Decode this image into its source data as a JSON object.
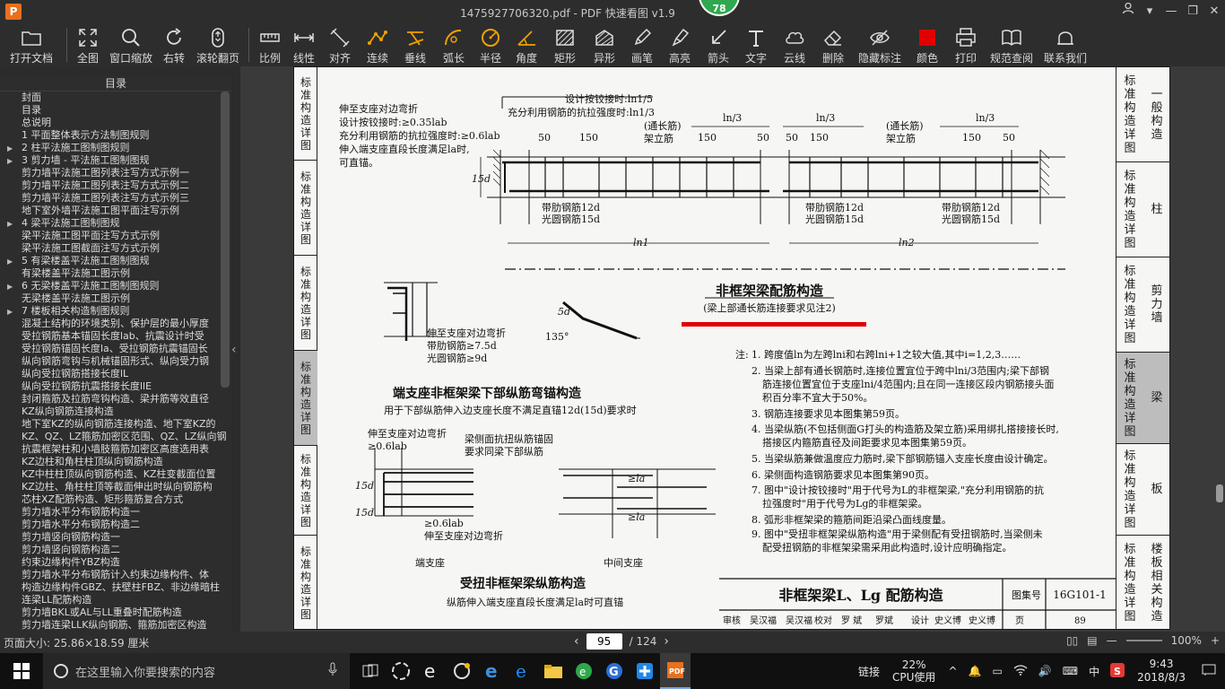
{
  "window": {
    "title": "1475927706320.pdf - PDF 快速看图 v1.9",
    "logo": "P",
    "badge": "78"
  },
  "toolbar": [
    {
      "id": "open",
      "label": "打开文档",
      "icon": "folder-icon"
    },
    {
      "id": "fit",
      "label": "全图",
      "icon": "fullscreen-icon"
    },
    {
      "id": "zoomwin",
      "label": "窗口缩放",
      "icon": "magnifier-icon"
    },
    {
      "id": "rotate",
      "label": "右转",
      "icon": "rotate-icon"
    },
    {
      "id": "scroll",
      "label": "滚轮翻页",
      "icon": "mouse-icon"
    },
    {
      "id": "scale",
      "label": "比例",
      "icon": "ruler-icon"
    },
    {
      "id": "linear",
      "label": "线性",
      "icon": "linear-dim-icon"
    },
    {
      "id": "align",
      "label": "对齐",
      "icon": "aligned-dim-icon"
    },
    {
      "id": "chain",
      "label": "连续",
      "icon": "chain-dim-icon"
    },
    {
      "id": "perp",
      "label": "垂线",
      "icon": "perpendicular-icon"
    },
    {
      "id": "arclen",
      "label": "弧长",
      "icon": "arc-length-icon"
    },
    {
      "id": "radius",
      "label": "半径",
      "icon": "radius-icon"
    },
    {
      "id": "angle",
      "label": "角度",
      "icon": "angle-icon"
    },
    {
      "id": "rect",
      "label": "矩形",
      "icon": "rectangle-area-icon"
    },
    {
      "id": "poly",
      "label": "异形",
      "icon": "polygon-area-icon"
    },
    {
      "id": "pen",
      "label": "画笔",
      "icon": "pen-icon"
    },
    {
      "id": "highlight",
      "label": "高亮",
      "icon": "highlighter-icon"
    },
    {
      "id": "arrow",
      "label": "箭头",
      "icon": "arrow-icon"
    },
    {
      "id": "text",
      "label": "文字",
      "icon": "text-icon"
    },
    {
      "id": "cloud",
      "label": "云线",
      "icon": "cloud-line-icon"
    },
    {
      "id": "erase",
      "label": "删除",
      "icon": "eraser-icon"
    },
    {
      "id": "hide",
      "label": "隐藏标注",
      "icon": "eye-hide-icon"
    },
    {
      "id": "color",
      "label": "颜色",
      "icon": "color-swatch-icon"
    },
    {
      "id": "print",
      "label": "打印",
      "icon": "printer-icon"
    },
    {
      "id": "spec",
      "label": "规范查阅",
      "icon": "book-icon"
    },
    {
      "id": "contact",
      "label": "联系我们",
      "icon": "user-icon"
    }
  ],
  "accent_color": "#e00000",
  "sidebar": {
    "title": "目录",
    "items": [
      {
        "text": "封面",
        "level": 1,
        "expand": false
      },
      {
        "text": "目录",
        "level": 1,
        "expand": false
      },
      {
        "text": "总说明",
        "level": 1,
        "expand": false
      },
      {
        "text": "1 平面整体表示方法制图规则",
        "level": 1,
        "expand": false
      },
      {
        "text": "2 柱平法施工图制图规则",
        "level": 1,
        "expand": true
      },
      {
        "text": "3 剪力墙 - 平法施工图制图规",
        "level": 1,
        "expand": true
      },
      {
        "text": "剪力墙平法施工图列表注写方式示例一",
        "level": 2,
        "expand": false
      },
      {
        "text": "剪力墙平法施工图列表注写方式示例二",
        "level": 2,
        "expand": false
      },
      {
        "text": "剪力墙平法施工图列表注写方式示例三",
        "level": 2,
        "expand": false
      },
      {
        "text": "地下室外墙平法施工图平面注写示例",
        "level": 2,
        "expand": false
      },
      {
        "text": "4 梁平法施工图制图规",
        "level": 1,
        "expand": true
      },
      {
        "text": "梁平法施工图平面注写方式示例",
        "level": 2,
        "expand": false
      },
      {
        "text": "梁平法施工图截面注写方式示例",
        "level": 2,
        "expand": false
      },
      {
        "text": "5 有梁楼盖平法施工图制图规",
        "level": 1,
        "expand": true
      },
      {
        "text": "有梁楼盖平法施工图示例",
        "level": 2,
        "expand": false
      },
      {
        "text": "6 无梁楼盖平法施工图制图规则",
        "level": 1,
        "expand": true
      },
      {
        "text": "无梁楼盖平法施工图示例",
        "level": 2,
        "expand": false
      },
      {
        "text": "7 楼板相关构造制图规则",
        "level": 1,
        "expand": true
      },
      {
        "text": "混凝土结构的环境类别、保护层的最小厚度",
        "level": 2,
        "expand": false
      },
      {
        "text": "受拉钢筋基本锚固长度lab、抗震设计时受",
        "level": 2,
        "expand": false
      },
      {
        "text": "受拉钢筋锚固长度la、受拉钢筋抗震锚固长",
        "level": 2,
        "expand": false
      },
      {
        "text": "纵向钢筋弯钩与机械锚固形式、纵向受力钢",
        "level": 2,
        "expand": false
      },
      {
        "text": "纵向受拉钢筋搭接长度lL",
        "level": 2,
        "expand": false
      },
      {
        "text": "纵向受拉钢筋抗震搭接长度llE",
        "level": 2,
        "expand": false
      },
      {
        "text": "封闭箍筋及拉筋弯钩构造、梁并筋等效直径",
        "level": 2,
        "expand": false
      },
      {
        "text": "KZ纵向钢筋连接构造",
        "level": 2,
        "expand": false
      },
      {
        "text": "地下室KZ的纵向钢筋连接构造、地下室KZ的",
        "level": 2,
        "expand": false
      },
      {
        "text": "KZ、QZ、LZ箍筋加密区范围、QZ、LZ纵向钢",
        "level": 2,
        "expand": false
      },
      {
        "text": "抗震框架柱和小墙肢箍筋加密区高度选用表",
        "level": 2,
        "expand": false
      },
      {
        "text": "KZ边柱和角柱柱顶纵向钢筋构造",
        "level": 2,
        "expand": false
      },
      {
        "text": "KZ中柱柱顶纵向钢筋构造、KZ柱变截面位置",
        "level": 2,
        "expand": false
      },
      {
        "text": "KZ边柱、角柱柱顶等截面伸出时纵向钢筋构",
        "level": 2,
        "expand": false
      },
      {
        "text": "芯柱XZ配筋构造、矩形箍筋复合方式",
        "level": 2,
        "expand": false
      },
      {
        "text": "剪力墙水平分布钢筋构造一",
        "level": 2,
        "expand": false
      },
      {
        "text": "剪力墙水平分布钢筋构造二",
        "level": 2,
        "expand": false
      },
      {
        "text": "剪力墙竖向钢筋构造一",
        "level": 2,
        "expand": false
      },
      {
        "text": "剪力墙竖向钢筋构造二",
        "level": 2,
        "expand": false
      },
      {
        "text": "约束边缘构件YBZ构造",
        "level": 2,
        "expand": false
      },
      {
        "text": "剪力墙水平分布钢筋计入约束边缘构件、体",
        "level": 2,
        "expand": false
      },
      {
        "text": "构造边缘构件GBZ、扶壁柱FBZ、非边缘暗柱",
        "level": 2,
        "expand": false
      },
      {
        "text": "连梁LL配筋构造",
        "level": 2,
        "expand": false
      },
      {
        "text": "剪力墙BKL或AL与LL重叠时配筋构造",
        "level": 2,
        "expand": false
      },
      {
        "text": "剪力墙连梁LLK纵向钢筋、箍筋加密区构造",
        "level": 2,
        "expand": false
      }
    ]
  },
  "page": {
    "left_tabs": [
      {
        "text": "标准构造详图",
        "active": false
      },
      {
        "text": "标准构造详图",
        "active": false
      },
      {
        "text": "标准构造详图",
        "active": false
      },
      {
        "text": "标准构造详图",
        "active": true
      },
      {
        "text": "标准构造详图",
        "active": false
      },
      {
        "text": "标准构造详图",
        "active": false
      }
    ],
    "right_tabs": [
      {
        "col1": "标准构造详图",
        "col2": "一般构造",
        "active": false
      },
      {
        "col1": "标准构造详图",
        "col2": "柱",
        "active": false
      },
      {
        "col1": "标准构造详图",
        "col2": "剪力墙",
        "active": false
      },
      {
        "col1": "标准构造详图",
        "col2": "梁",
        "active": true
      },
      {
        "col1": "标准构造详图",
        "col2": "板",
        "active": false
      },
      {
        "col1": "标准构造详图",
        "col2": "楼板相关构造",
        "active": false
      }
    ],
    "drawing": {
      "top_notes": [
        "伸至支座对边弯折",
        "设计按铰接时:≥0.35lab",
        "充分利用钢筋的抗拉强度时:≥0.6lab",
        "伸入端支座直段长度满足la时,",
        "可直锚。"
      ],
      "top_center_notes": [
        "设计按铰接时:ln1/5",
        "充分利用钢筋的抗拉强度时:ln1/3"
      ],
      "dims_ln3": [
        "ln/3",
        "ln/3",
        "ln/3"
      ],
      "through_bar": [
        "(通长筋)",
        "架立筋"
      ],
      "dim50": "50",
      "dim150": "150",
      "rib12": "带肋钢筋12d",
      "round15": "光圆钢筋15d",
      "ln1": "ln1",
      "ln2": "ln2",
      "d15": "15d",
      "main_title": "非框架梁配筋构造",
      "main_subtitle": "(梁上部通长筋连接要求见注2)",
      "hook_5d": "5d",
      "hook_135": "135°",
      "anchor_notes": [
        "伸至支座对边弯折",
        "带肋钢筋≥7.5d",
        "光圆钢筋≥9d"
      ],
      "end_support_title": "端支座非框架梁下部纵筋弯锚构造",
      "end_support_sub": "用于下部纵筋伸入边支座长度不满足直锚12d(15d)要求时",
      "tors_notes_left": [
        "伸至支座对边弯折",
        "≥0.6lab"
      ],
      "tors_note_mid": [
        "梁侧面抗扭纵筋锚固",
        "要求同梁下部纵筋"
      ],
      "tors_note_bottom": [
        "≥0.6lab",
        "伸至支座对边弯折"
      ],
      "la1": "≥la",
      "la2": "≥la",
      "end_support": "端支座",
      "mid_support": "中间支座",
      "torsion_title": "受扭非框架梁纵筋构造",
      "torsion_sub": "纵筋伸入端支座直段长度满足la时可直锚",
      "notes_label": "注:",
      "notes": [
        "1. 跨度值ln为左跨lni和右跨lni+1之较大值,其中i=1,2,3……",
        "2. 当梁上部有通长钢筋时,连接位置宜位于跨中lni/3范围内;梁下部钢",
        "筋连接位置宜位于支座lni/4范围内;且在同一连接区段内钢筋接头面",
        "积百分率不宜大于50%。",
        "3. 钢筋连接要求见本图集第59页。",
        "4. 当梁纵筋(不包括侧面G打头的构造筋及架立筋)采用绑扎搭接接长时,",
        "搭接区内箍筋直径及间距要求见本图集第59页。",
        "5. 当梁纵筋兼做温度应力筋时,梁下部钢筋锚入支座长度由设计确定。",
        "6. 梁侧面构造钢筋要求见本图集第90页。",
        "7. 图中\"设计按铰接时\"用于代号为L的非框架梁,\"充分利用钢筋的抗",
        "拉强度时\"用于代号为Lg的非框架梁。",
        "8. 弧形非框架梁的箍筋间距沿梁凸面线度量。",
        "9. 图中\"受扭非框架梁纵筋构造\"用于梁侧配有受扭钢筋时,当梁侧未",
        "配受扭钢筋的非框架梁需采用此构造时,设计应明确指定。"
      ],
      "titleblock": {
        "title": "非框架梁L、Lg 配筋构造",
        "atlas_label": "图集号",
        "atlas_no": "16G101-1",
        "row2": [
          "审核",
          "吴汉福",
          "吴汉福",
          "校对",
          "罗 斌",
          "罗斌",
          "设计",
          "史义博",
          "史义博",
          "页",
          "89"
        ]
      }
    }
  },
  "statusbar": {
    "page_size": "页面大小: 25.86×18.59 厘米",
    "current_page": "95",
    "total_pages": "/ 124",
    "zoom": "100%"
  },
  "taskbar": {
    "search_placeholder": "在这里输入你要搜索的内容",
    "network_label": "链接",
    "cpu_percent": "22%",
    "cpu_label": "CPU使用",
    "ime": "中",
    "time": "9:43",
    "date": "2018/8/3"
  }
}
